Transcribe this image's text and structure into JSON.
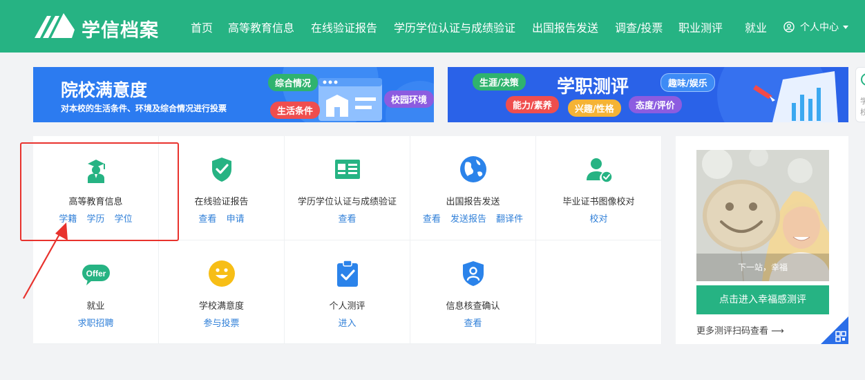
{
  "header": {
    "logo_text": "学信档案",
    "nav": [
      "首页",
      "高等教育信息",
      "在线验证报告",
      "学历学位认证与成绩验证",
      "出国报告发送",
      "调查/投票",
      "职业测评",
      "就业"
    ],
    "user_menu": "个人中心"
  },
  "banner_left": {
    "title": "院校满意度",
    "subtitle": "对本校的生活条件、环境及综合情况进行投票",
    "tags": [
      "综合情况",
      "生活条件",
      "校园环境"
    ]
  },
  "banner_right": {
    "title": "学职测评",
    "tags": [
      "生涯/决策",
      "能力/素养",
      "兴趣/性格",
      "态度/评价",
      "趣味/娱乐"
    ]
  },
  "edge_card": {
    "chars": [
      "学",
      "校"
    ]
  },
  "services": [
    {
      "title": "高等教育信息",
      "links": [
        "学籍",
        "学历",
        "学位"
      ],
      "icon": "graduate-icon"
    },
    {
      "title": "在线验证报告",
      "links": [
        "查看",
        "申请"
      ],
      "icon": "shield-check-icon"
    },
    {
      "title": "学历学位认证与成绩验证",
      "links": [
        "查看"
      ],
      "icon": "id-card-icon"
    },
    {
      "title": "出国报告发送",
      "links": [
        "查看",
        "发送报告",
        "翻译件"
      ],
      "icon": "globe-icon"
    },
    {
      "title": "毕业证书图像校对",
      "links": [
        "校对"
      ],
      "icon": "user-check-icon"
    },
    {
      "title": "就业",
      "links": [
        "求职招聘"
      ],
      "icon": "offer-icon",
      "badge": "Offer"
    },
    {
      "title": "学校满意度",
      "links": [
        "参与投票"
      ],
      "icon": "smiley-icon"
    },
    {
      "title": "个人测评",
      "links": [
        "进入"
      ],
      "icon": "clipboard-check-icon"
    },
    {
      "title": "信息核查确认",
      "links": [
        "查看"
      ],
      "icon": "shield-user-icon"
    }
  ],
  "side": {
    "photo_caption": "下一站，幸福",
    "cta": "点击进入幸福感测评",
    "more": "更多测评扫码查看 ⟶"
  },
  "colors": {
    "brand": "#26b383",
    "link": "#2f7fd8",
    "highlight": "#e8322d"
  }
}
